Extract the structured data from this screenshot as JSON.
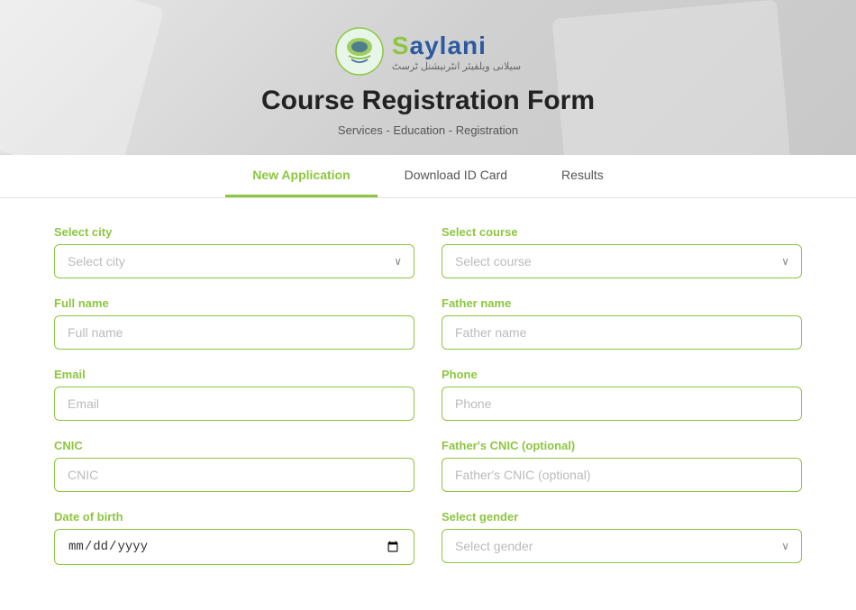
{
  "page": {
    "title": "Course Registration Form",
    "breadcrumb": "Services - Education - Registration"
  },
  "logo": {
    "brand_text": "Saylani",
    "urdu_text": "سیلانی ویلفیئر انٹرنیشنل ٹرسٹ"
  },
  "tabs": [
    {
      "id": "new-application",
      "label": "New Application",
      "active": true
    },
    {
      "id": "download-id-card",
      "label": "Download ID Card",
      "active": false
    },
    {
      "id": "results",
      "label": "Results",
      "active": false
    }
  ],
  "form": {
    "fields": {
      "select_city_label": "Select city",
      "select_city_placeholder": "Select city",
      "select_course_label": "Select course",
      "select_course_placeholder": "Select course",
      "full_name_label": "Full name",
      "full_name_placeholder": "Full name",
      "father_name_label": "Father name",
      "father_name_placeholder": "Father name",
      "email_label": "Email",
      "email_placeholder": "Email",
      "phone_label": "Phone",
      "phone_placeholder": "Phone",
      "cnic_label": "CNIC",
      "cnic_placeholder": "CNIC",
      "fathers_cnic_label": "Father's CNIC (optional)",
      "fathers_cnic_placeholder": "Father's CNIC (optional)",
      "dob_label": "Date of birth",
      "dob_placeholder": "mm/dd/yyyy",
      "select_gender_label": "Select gender",
      "select_gender_placeholder": "Select gender"
    }
  }
}
